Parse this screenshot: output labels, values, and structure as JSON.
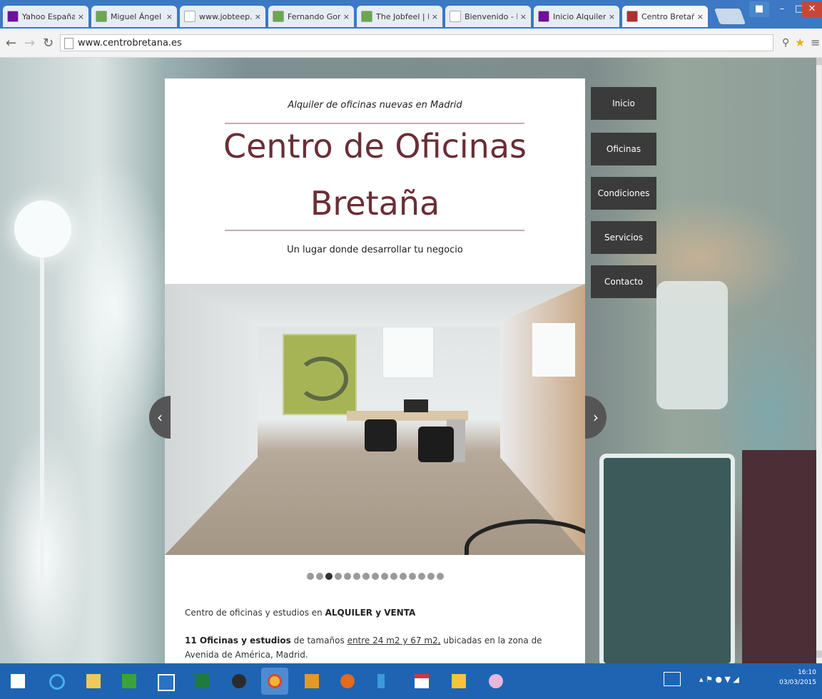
{
  "browser": {
    "tabs": [
      {
        "label": "Yahoo España",
        "icon": "yahoo-icon",
        "color": "#720e9e"
      },
      {
        "label": "Miguel Ángel Mé",
        "icon": "globe-icon",
        "color": "#6aa84f"
      },
      {
        "label": "www.jobteep.co",
        "icon": "page-icon",
        "color": "#ffffff"
      },
      {
        "label": "Fernando Gonzál",
        "icon": "globe-icon",
        "color": "#6aa84f"
      },
      {
        "label": "The Jobfeel | Par",
        "icon": "globe-icon",
        "color": "#6aa84f"
      },
      {
        "label": "Bienvenido - Invi",
        "icon": "page-icon",
        "color": "#ffffff"
      },
      {
        "label": "Inicio Alquiler Co",
        "icon": "yahoo-icon",
        "color": "#720e9e"
      },
      {
        "label": "Centro Bretaña -",
        "icon": "site-icon",
        "color": "#b03030"
      }
    ],
    "url": "www.centrobretana.es"
  },
  "page": {
    "kicker": "Alquiler de oficinas nuevas en Madrid",
    "title_line1": "Centro de Oficinas",
    "title_line2": "Bretaña",
    "tagline": "Un lugar donde desarrollar tu negocio",
    "slide_count": 15,
    "active_slide": 3,
    "para1_pre": "Centro de oficinas y estudios en ",
    "para1_bold": "ALQUILER y VENTA",
    "para2_bold": "11 Oficinas y estudios",
    "para2_mid": " de tamaños ",
    "para2_u": "entre 24 m2 y 67 m2,",
    "para2_post": " ubicadas en la zona de Avenida de América, Madrid."
  },
  "menu": {
    "items": [
      "Inicio",
      "Oficinas",
      "Condiciones",
      "Servicios",
      "Contacto"
    ]
  },
  "taskbar": {
    "time": "16:10",
    "date": "03/03/2015"
  }
}
